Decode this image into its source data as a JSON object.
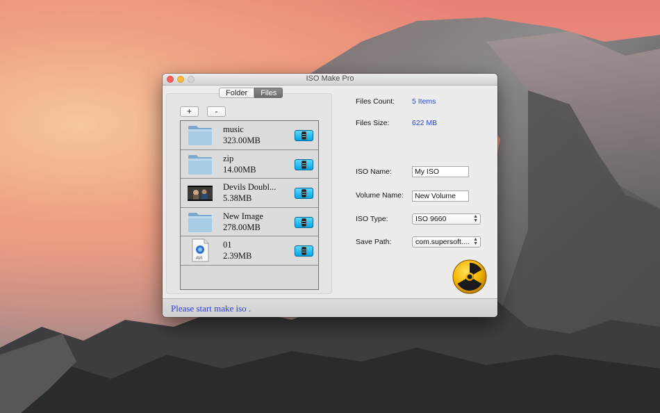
{
  "window": {
    "title": "ISO Make Pro"
  },
  "tabs": [
    {
      "label": "Folder",
      "active": false
    },
    {
      "label": "Files",
      "active": true
    }
  ],
  "toolbar": {
    "add_label": "+",
    "remove_label": "-"
  },
  "files": [
    {
      "name": "music",
      "size": "323.00MB",
      "icon": "folder-icon"
    },
    {
      "name": "zip",
      "size": "14.00MB",
      "icon": "folder-icon"
    },
    {
      "name": "Devils Doubl...",
      "size": "5.38MB",
      "icon": "video-thumbnail-icon"
    },
    {
      "name": "New Image",
      "size": "278.00MB",
      "icon": "folder-icon"
    },
    {
      "name": "01",
      "size": "2.39MB",
      "icon": "avi-file-icon"
    }
  ],
  "info": {
    "files_count_label": "Files Count:",
    "files_count_value": "5 Items",
    "files_size_label": "Files Size:",
    "files_size_value": "622 MB"
  },
  "form": {
    "iso_name_label": "ISO Name:",
    "iso_name_value": "My ISO",
    "volume_name_label": "Volume Name:",
    "volume_name_value": "New Volume",
    "iso_type_label": "ISO Type:",
    "iso_type_value": "ISO 9660",
    "save_path_label": "Save Path:",
    "save_path_value": "com.supersoft...."
  },
  "status": {
    "text": "Please start make iso ."
  },
  "colors": {
    "value_blue": "#2745d6",
    "status_blue": "#2a3ee0",
    "info_button": "#00a7e6",
    "burn_yellow": "#f5b400"
  }
}
